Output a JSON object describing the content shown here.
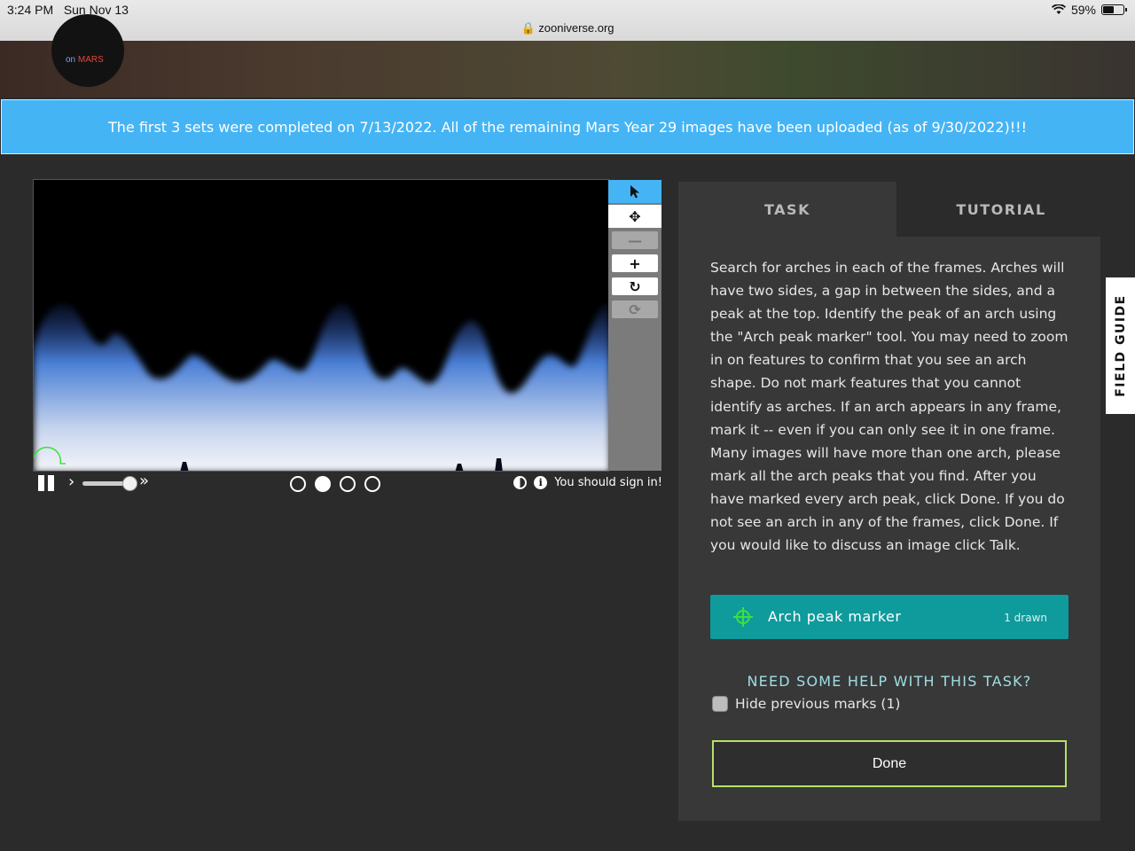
{
  "status_bar": {
    "time": "3:24 PM",
    "date": "Sun Nov 13",
    "url": "zooniverse.org",
    "battery": "59%",
    "battery_level": 0.59
  },
  "logo": {
    "on": "on",
    "mars": "MARS"
  },
  "announcement": "The first 3 sets were completed on 7/13/2022. All of the remaining Mars Year 29 images have been uploaded (as of 9/30/2022)!!!",
  "viewer": {
    "toolbar": [
      "pointer-icon",
      "move-icon",
      "zoom-out-icon",
      "zoom-in-icon",
      "rotate-icon",
      "reset-icon"
    ],
    "frames": [
      false,
      true,
      false,
      false
    ],
    "speed_level": 0.9,
    "sign_in_text": "You should sign in!"
  },
  "tabs": {
    "task": "TASK",
    "tutorial": "TUTORIAL"
  },
  "task": {
    "instructions": "Search for arches in each of the frames. Arches will have two sides, a gap in between the sides, and a peak at the top. Identify the peak of an arch using the \"Arch peak marker\" tool. You may need to zoom in on features to confirm that you see an arch shape. Do not mark features that you cannot identify as arches. If an arch appears in any frame, mark it -- even if you can only see it in one frame. Many images will have more than one arch, please mark all the arch peaks that you find. After you have marked every arch peak, click Done. If you do not see an arch in any of the frames, click Done. If you would like to discuss an image click Talk.",
    "tool_label": "Arch peak marker",
    "tool_count": "1 drawn",
    "help": "NEED SOME HELP WITH THIS TASK?",
    "hide_marks": "Hide previous marks (1)",
    "done": "Done"
  },
  "field_guide": "FIELD GUIDE",
  "colors": {
    "accent": "#45b4f5",
    "tool": "#0f9a9c",
    "done_border": "#b5e06a",
    "marker": "#3de03d"
  }
}
